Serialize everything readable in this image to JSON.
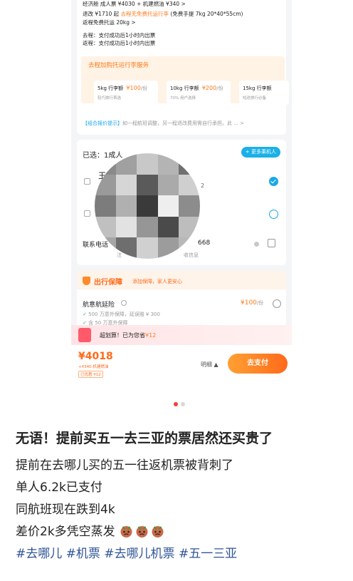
{
  "booking": {
    "cabin_line": "经济舱   成人票 ¥4030 + 机建燃油 ¥340 >",
    "refund_prefix": "退改 ¥1710 起",
    "refund_highlight": "去程无免费托运行李",
    "refund_suffix": "(免费手提 7kg 20*40*55cm)",
    "return_baggage": "返程免费托运 20kg >",
    "outbound_ticketing": "去程：支付成功后1小时内出票",
    "return_ticketing": "返程：支付成功后1小时内出票",
    "baggage_section_title": "去程加购托运行李服务",
    "baggage_options": [
      {
        "weight": "5kg 行李额",
        "price": "¥100",
        "unit": "/份",
        "note": "轻巧旅行首选"
      },
      {
        "weight": "10kg 行李额",
        "price": "¥200",
        "unit": "/份",
        "note": "70% 用户选择"
      },
      {
        "weight": "15kg 行李额",
        "price": "",
        "unit": "",
        "note": "短途旅行必备"
      }
    ],
    "combo_tag": "【组合报价提示】",
    "combo_text": "如一程航班调整，另一程退改费用需自行承担。此 ... >",
    "selected_label": "已选：1成人",
    "more_passengers": "+ 更多乘机人",
    "passenger1_initial": "王",
    "passenger1_trailing": "2",
    "contact_label": "联系电话",
    "contact_trailing": "668",
    "contact_hint_a": "注",
    "contact_hint_b": "收信息",
    "insurance_title": "出行保障",
    "insurance_sub": "添加保障，家人更安心",
    "delay_name": "航意航延险",
    "delay_price": "¥100",
    "delay_unit": "/份",
    "delay_feat1": "500 万意外保障，延误赔 ¥ 300",
    "delay_feat2": "含 50 万意外保障",
    "promo_text": "超划算！已为您省",
    "promo_amount": "¥12",
    "total_price": "¥4018",
    "total_sub1": "+¥340 机建燃油",
    "total_sub2": "已优惠 ¥12",
    "details_label": "明细 ▲",
    "pay_button": "去支付"
  },
  "post": {
    "title": "无语！提前买五一去三亚的票居然还买贵了",
    "lines": [
      "提前在去哪儿买的五一往返机票被背刺了",
      "单人6.2k已支付",
      "同航班现在跌到4k",
      "差价2k多凭空蒸发"
    ],
    "tags": "#去哪儿 #机票 #去哪儿机票 #五一三亚"
  },
  "colors": {
    "accent": "#ff7a1a",
    "pay_gradient_start": "#ffa033",
    "pay_gradient_end": "#ff6a1a",
    "check_blue": "#1aa7e8",
    "tag_blue": "#2f5597",
    "mosaic": [
      "#8a8a8a",
      "#a0a0a0",
      "#c8c8c8",
      "#b4b4b4",
      "#707070",
      "#9a9a9a",
      "#d6d6d6",
      "#5a5a5a",
      "#aaaaaa",
      "#cfcfcf",
      "#7c7c7c",
      "#b0b0b0",
      "#3a3a3a",
      "#eeeeee",
      "#8c8c8c",
      "#c0c0c0",
      "#e2e2e2",
      "#969696",
      "#4a4a4a",
      "#bdbdbd",
      "#a6a6a6",
      "#6e6e6e",
      "#d0d0d0",
      "#9c9c9c",
      "#b8b8b8"
    ]
  },
  "carousel": {
    "active_index": 0,
    "count": 2
  }
}
